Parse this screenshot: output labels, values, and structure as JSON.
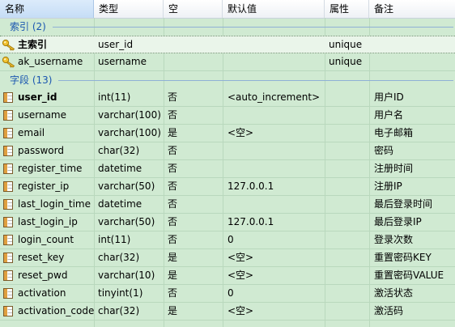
{
  "columns": [
    "名称",
    "类型",
    "空",
    "默认值",
    "属性",
    "备注"
  ],
  "indexes_section": {
    "title": "索引 (2)"
  },
  "indexes": [
    {
      "name": "主索引",
      "type": "user_id",
      "attribute": "unique",
      "bold": true,
      "selected": true
    },
    {
      "name": "ak_username",
      "type": "username",
      "attribute": "unique",
      "bold": false,
      "selected": false
    }
  ],
  "fields_section": {
    "title": "字段 (13)"
  },
  "fields": [
    {
      "name": "user_id",
      "type": "int(11)",
      "null": "否",
      "default": "<auto_increment>",
      "comment": "用户ID",
      "bold": true
    },
    {
      "name": "username",
      "type": "varchar(100)",
      "null": "否",
      "default": "",
      "comment": "用户名",
      "bold": false
    },
    {
      "name": "email",
      "type": "varchar(100)",
      "null": "是",
      "default": "<空>",
      "comment": "电子邮箱",
      "bold": false
    },
    {
      "name": "password",
      "type": "char(32)",
      "null": "否",
      "default": "",
      "comment": "密码",
      "bold": false
    },
    {
      "name": "register_time",
      "type": "datetime",
      "null": "否",
      "default": "",
      "comment": "注册时间",
      "bold": false
    },
    {
      "name": "register_ip",
      "type": "varchar(50)",
      "null": "否",
      "default": "127.0.0.1",
      "comment": "注册IP",
      "bold": false
    },
    {
      "name": "last_login_time",
      "type": "datetime",
      "null": "否",
      "default": "",
      "comment": "最后登录时间",
      "bold": false
    },
    {
      "name": "last_login_ip",
      "type": "varchar(50)",
      "null": "否",
      "default": "127.0.0.1",
      "comment": "最后登录IP",
      "bold": false
    },
    {
      "name": "login_count",
      "type": "int(11)",
      "null": "否",
      "default": "0",
      "comment": "登录次数",
      "bold": false
    },
    {
      "name": "reset_key",
      "type": "char(32)",
      "null": "是",
      "default": "<空>",
      "comment": "重置密码KEY",
      "bold": false
    },
    {
      "name": "reset_pwd",
      "type": "varchar(10)",
      "null": "是",
      "default": "<空>",
      "comment": "重置密码VALUE",
      "bold": false
    },
    {
      "name": "activation",
      "type": "tinyint(1)",
      "null": "否",
      "default": "0",
      "comment": "激活状态",
      "bold": false
    },
    {
      "name": "activation_code",
      "type": "char(32)",
      "null": "是",
      "default": "<空>",
      "comment": "激活码",
      "bold": false
    }
  ],
  "icons": {
    "index": "key-icon",
    "field": "table-column-icon"
  },
  "colors": {
    "background": "#d0ead2",
    "section_title": "#1a56b0",
    "header_selected": "#c5ddf6"
  }
}
